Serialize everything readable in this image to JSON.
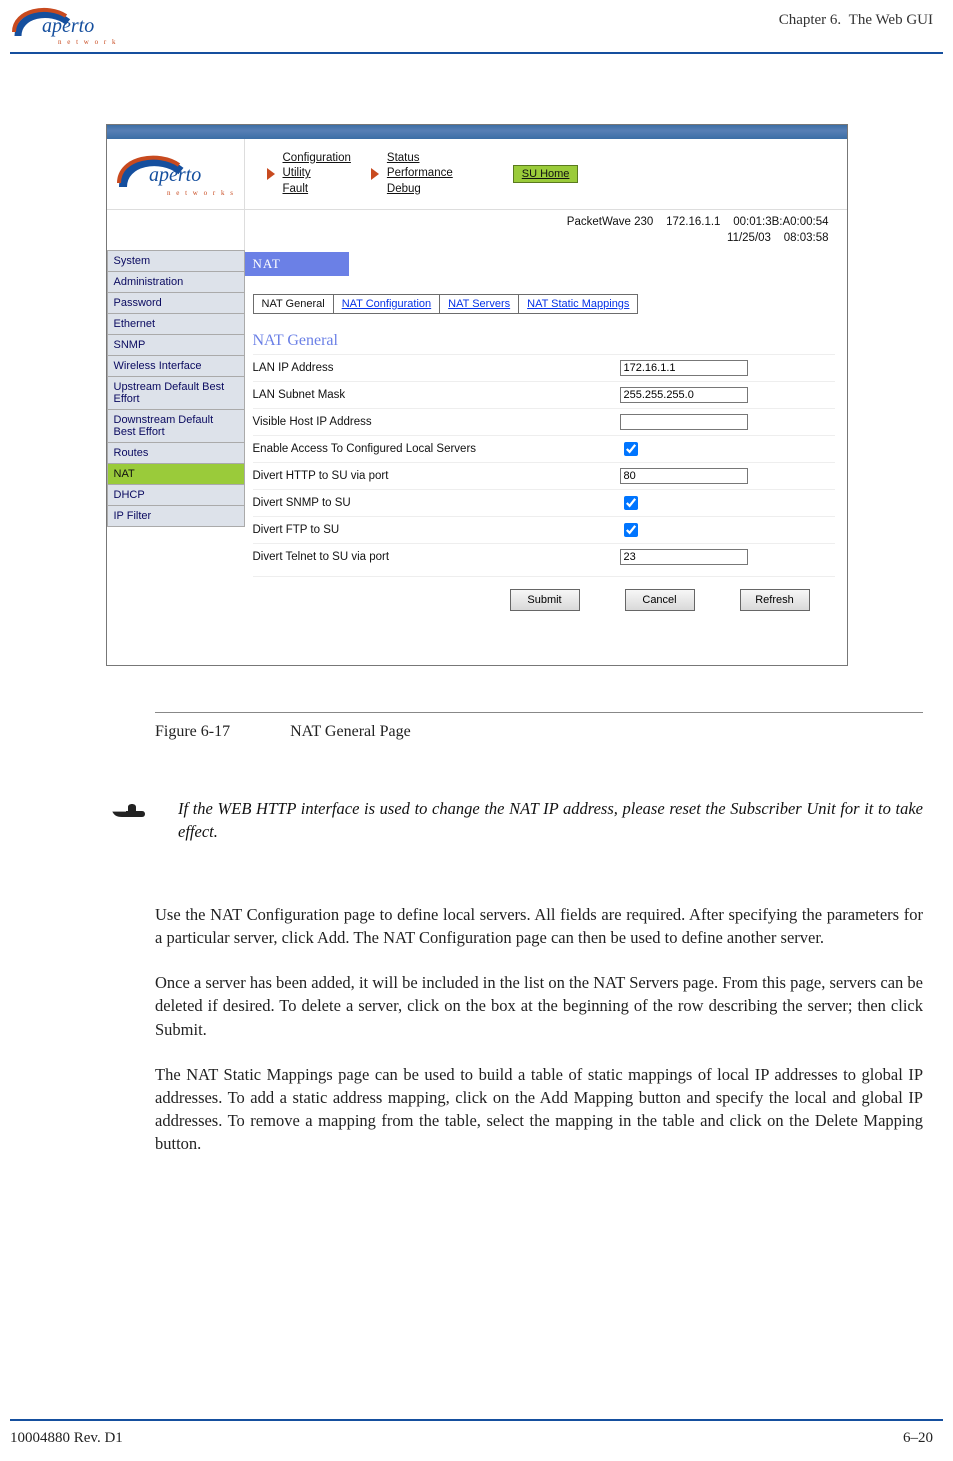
{
  "header": {
    "chapter_label": "Chapter 6.",
    "chapter_title": "The Web GUI",
    "logo_word1": "aperto",
    "logo_word2": "n e t w o r k s"
  },
  "screenshot": {
    "topnav_group1": [
      "Configuration",
      "Utility",
      "Fault"
    ],
    "topnav_group2": [
      "Status",
      "Performance",
      "Debug"
    ],
    "home_btn": "SU Home",
    "device_info": {
      "model": "PacketWave 230",
      "ip": "172.16.1.1",
      "mac": "00:01:3B:A0:00:54",
      "date": "11/25/03",
      "time": "08:03:58"
    },
    "side_menu": [
      "System",
      "Administration",
      "Password",
      "Ethernet",
      "SNMP",
      "Wireless Interface",
      "Upstream Default Best Effort",
      "Downstream Default Best Effort",
      "Routes",
      "NAT",
      "DHCP",
      "IP Filter"
    ],
    "side_menu_active_index": 9,
    "panel_title": "NAT",
    "tabs": [
      "NAT General",
      "NAT Configuration",
      "NAT Servers",
      "NAT Static Mappings"
    ],
    "section_title": "NAT General",
    "fields": {
      "lan_ip_label": "LAN IP Address",
      "lan_ip_value": "172.16.1.1",
      "lan_mask_label": "LAN Subnet Mask",
      "lan_mask_value": "255.255.255.0",
      "visible_host_label": "Visible Host IP Address",
      "visible_host_value": "",
      "enable_access_label": "Enable Access To Configured Local Servers",
      "enable_access_checked": true,
      "divert_http_label": "Divert HTTP to SU via port",
      "divert_http_value": "80",
      "divert_snmp_label": "Divert SNMP to SU",
      "divert_snmp_checked": true,
      "divert_ftp_label": "Divert FTP to SU",
      "divert_ftp_checked": true,
      "divert_telnet_label": "Divert Telnet to SU via port",
      "divert_telnet_value": "23"
    },
    "buttons": {
      "submit": "Submit",
      "cancel": "Cancel",
      "refresh": "Refresh"
    },
    "logo_word1": "aperto",
    "logo_word2": "n e t w o r k s"
  },
  "caption": {
    "figure": "Figure 6-17",
    "title": "NAT General Page"
  },
  "note_text": "If the WEB HTTP interface is used to change the NAT IP address, please reset the Sub­scriber Unit for it to take effect.",
  "para1": "Use the NAT Configuration page to define local servers. All fields are required. After spec­ifying the parameters for a particular server, click Add. The NAT Configuration page can then be used to define another server.",
  "para2": "Once a server has been added, it will be included in the list on the NAT Servers page. From this page, servers can be deleted if desired. To delete a server, click on the box at the beginning of the row describing the server; then click Submit.",
  "para3": "The NAT Static Mappings page can be used to build a table of static mappings of local IP addresses to global IP addresses. To add a static address mapping, click on the Add Map­ping button and specify the local and global IP addresses. To remove a mapping from the table, select the mapping in the table and click on the Delete Mapping button.",
  "footer": {
    "docnum": "10004880 Rev. D1",
    "page": "6–20"
  }
}
